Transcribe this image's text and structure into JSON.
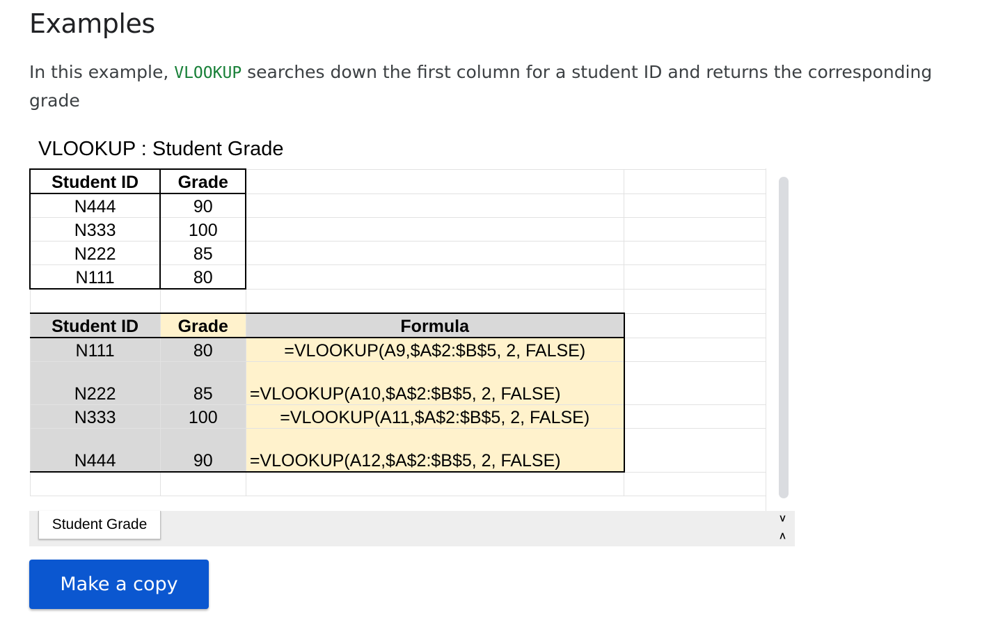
{
  "heading": "Examples",
  "intro": {
    "before": "In this example, ",
    "code": "VLOOKUP",
    "after": " searches down the first column for a student ID and returns the corresponding grade"
  },
  "embed_title": "VLOOKUP : Student Grade",
  "lookup_table": {
    "headers": [
      "Student ID",
      "Grade"
    ],
    "rows": [
      [
        "N444",
        "90"
      ],
      [
        "N333",
        "100"
      ],
      [
        "N222",
        "85"
      ],
      [
        "N111",
        "80"
      ]
    ]
  },
  "result_table": {
    "headers": [
      "Student ID",
      "Grade",
      "Formula"
    ],
    "rows": [
      [
        "N111",
        "80",
        "=VLOOKUP(A9,$A$2:$B$5, 2, FALSE)"
      ],
      [
        "N222",
        "85",
        "=VLOOKUP(A10,$A$2:$B$5, 2, FALSE)"
      ],
      [
        "N333",
        "100",
        "=VLOOKUP(A11,$A$2:$B$5, 2, FALSE)"
      ],
      [
        "N444",
        "90",
        "=VLOOKUP(A12,$A$2:$B$5, 2, FALSE)"
      ]
    ]
  },
  "sheet_tab": "Student Grade",
  "nav": {
    "up": ">",
    "down": "<"
  },
  "make_copy_label": "Make a copy",
  "colors": {
    "header_gray": "#d9d9d9",
    "highlight_yellow": "#fff2cc",
    "button_blue": "#0b57d0",
    "code_green": "#188038"
  }
}
